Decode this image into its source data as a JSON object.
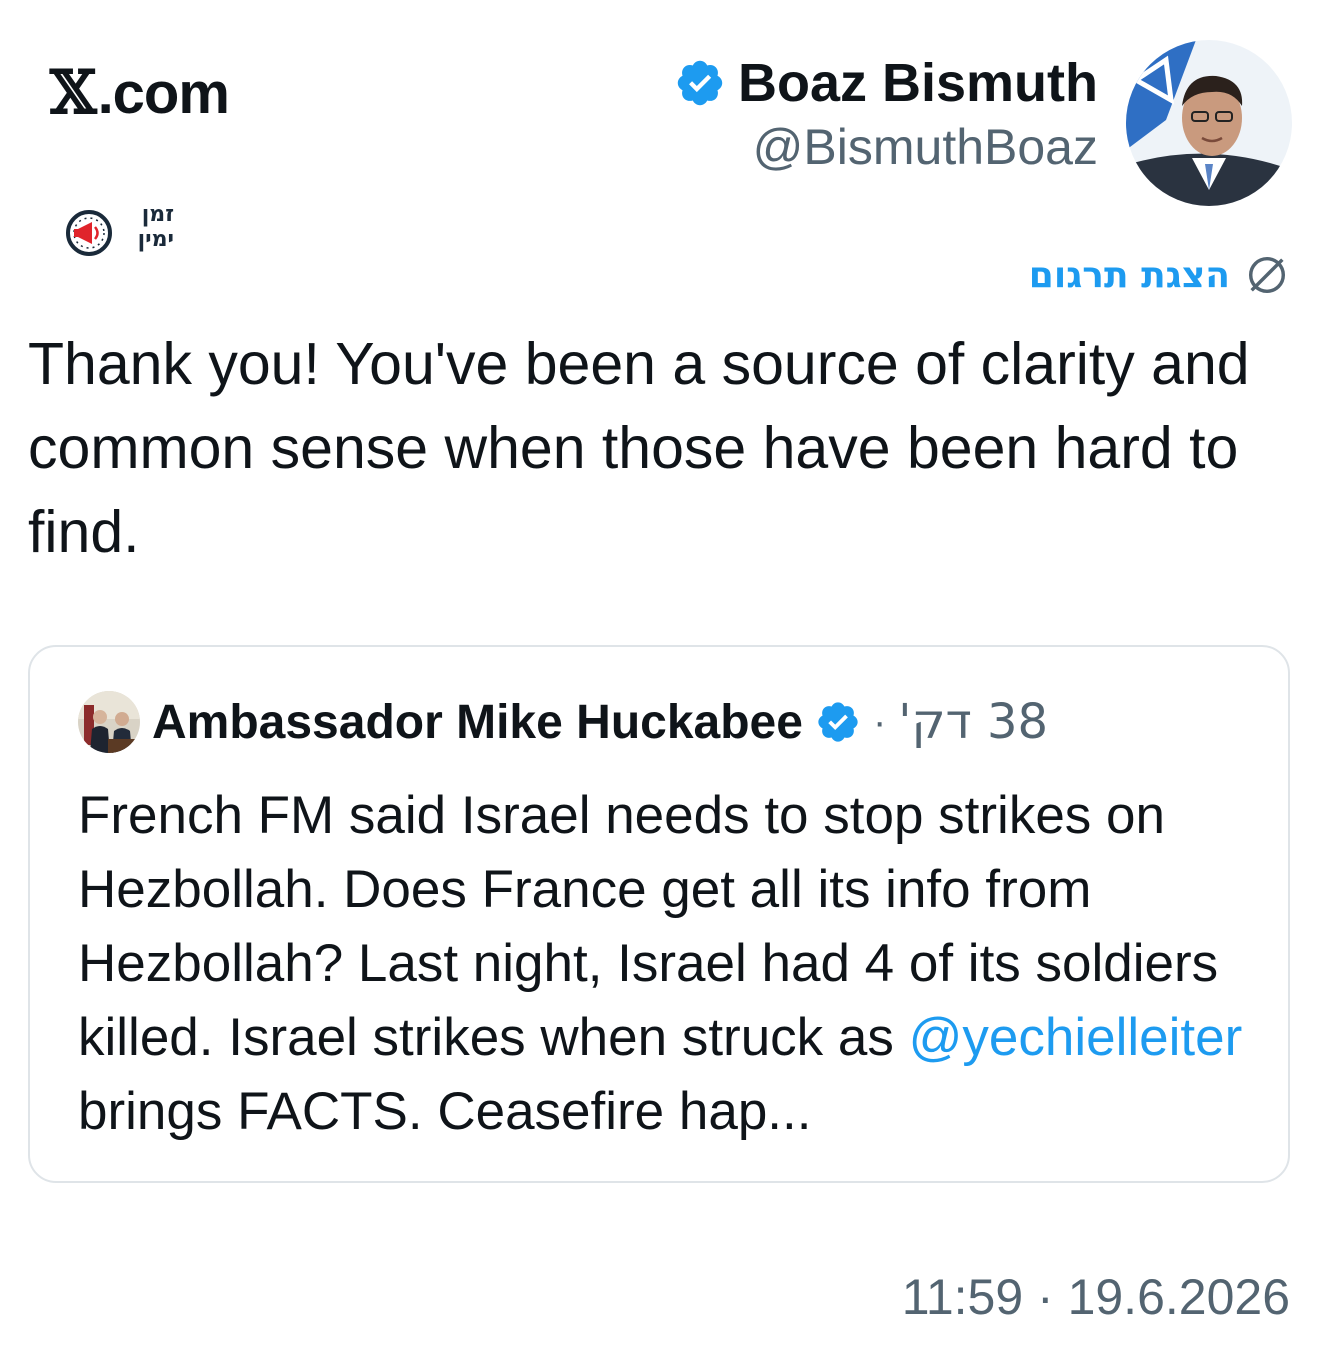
{
  "site": {
    "x_mark": "𝕏",
    "domain": ".com"
  },
  "brand_badge": {
    "line1": "זמן",
    "line2": "ימין"
  },
  "author": {
    "name": "Boaz Bismuth",
    "handle": "@BismuthBoaz"
  },
  "translate": {
    "label": "הצגת תרגום"
  },
  "tweet": {
    "text": "Thank you! You've been a source of clarity and common sense when those have been hard to find."
  },
  "quote": {
    "author_name": "Ambassador Mike Huckabee",
    "separator": "·",
    "time": "38 דק'",
    "text_before": "French FM said Israel needs to stop strikes on Hezbollah. Does France get all its info from Hezbollah? Last night, Israel had 4 of its soldiers killed. Israel strikes when struck as ",
    "mention": "@yechielleiter",
    "text_after": " brings FACTS. Ceasefire hap..."
  },
  "footer": {
    "timestamp": "11:59 · 19.6.2026"
  },
  "colors": {
    "accent": "#1d9bf0",
    "muted": "#536471",
    "text": "#0f1419",
    "border": "#dfe4e8"
  },
  "icons": {
    "verified": "verified-badge-icon",
    "translate": "translate-globe-icon",
    "brand": "megaphone-clock-icon"
  }
}
